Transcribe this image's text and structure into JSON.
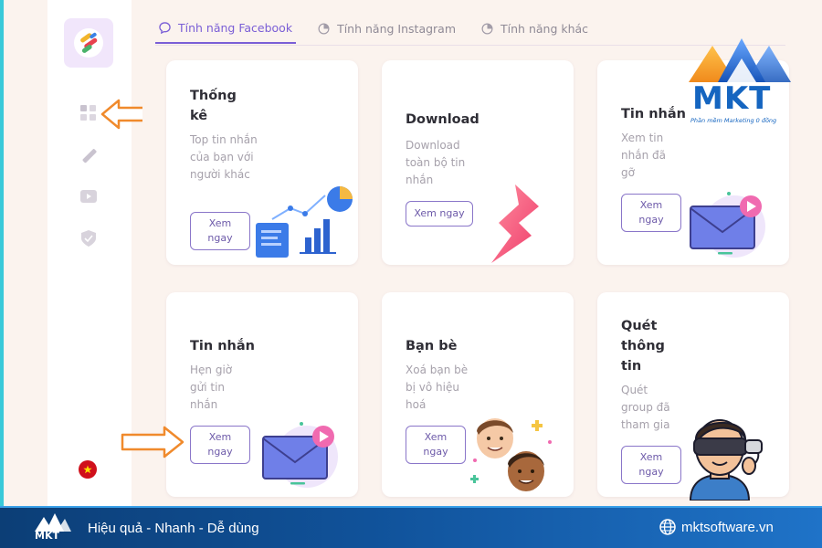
{
  "tabs": [
    {
      "label": "Tính năng Facebook",
      "active": true
    },
    {
      "label": "Tính năng Instagram",
      "active": false
    },
    {
      "label": "Tính năng khác",
      "active": false
    }
  ],
  "cards": [
    {
      "title": "Thống kê",
      "desc": "Top tin nhắn của bạn với người khác",
      "button": "Xem ngay",
      "icon": "statistics-chart-icon"
    },
    {
      "title": "Download",
      "desc": "Download toàn bộ tin nhắn",
      "button": "Xem ngay",
      "icon": "lightning-download-icon"
    },
    {
      "title": "Tin nhắn",
      "desc": "Xem tin nhắn đã gỡ",
      "button": "Xem ngay",
      "icon": "envelope-message-icon"
    },
    {
      "title": "Tin nhắn",
      "desc": "Hẹn giờ gửi tin nhắn",
      "button": "Xem ngay",
      "icon": "envelope-message-icon"
    },
    {
      "title": "Bạn bè",
      "desc": "Xoá bạn bè bị vô hiệu hoá",
      "button": "Xem ngay",
      "icon": "friends-faces-icon"
    },
    {
      "title": "Quét thông tin",
      "desc": "Quét group đã tham gia",
      "button": "Xem ngay",
      "icon": "vr-person-icon"
    }
  ],
  "brand": {
    "name": "MKT",
    "tagline": "Phần mềm Marketing 0 đồng"
  },
  "footer": {
    "logo": "MKT",
    "slogan": "Hiệu quả - Nhanh - Dễ dùng",
    "website": "mktsoftware.vn"
  },
  "colors": {
    "accent": "#7a5ed6",
    "brand_blue": "#1565c0",
    "arrow_orange": "#f08a2c",
    "footer_blue": "#10529a"
  }
}
